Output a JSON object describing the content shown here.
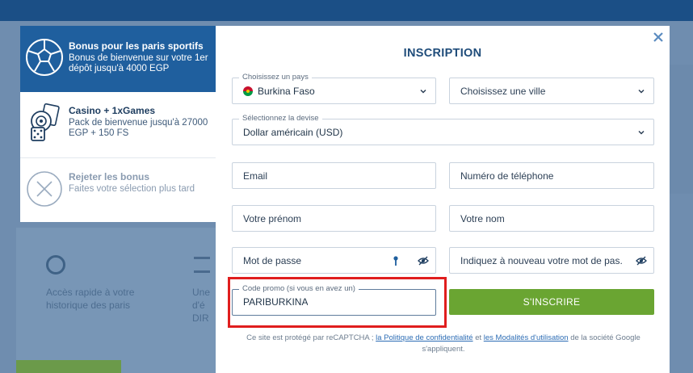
{
  "background": {
    "history_text": "Accès rapide à votre historique des paris",
    "side_text": "Une d'é DIR"
  },
  "bonus_panel": {
    "items": [
      {
        "title": "Bonus pour les paris sportifs",
        "desc": "Bonus de bienvenue sur votre 1er dépôt jusqu'à 4000 EGP",
        "icon": "soccer-ball-icon"
      },
      {
        "title": "Casino + 1xGames",
        "desc": "Pack de bienvenue jusqu'à 27000 EGP + 150 FS",
        "icon": "casino-chip-dice-icon"
      },
      {
        "title": "Rejeter les bonus",
        "desc": "Faites votre sélection plus tard",
        "icon": "close-circle-icon"
      }
    ]
  },
  "modal": {
    "title": "INSCRIPTION",
    "country": {
      "label": "Choisissez un pays",
      "value": "Burkina Faso"
    },
    "city": {
      "placeholder": "Choisissez une ville"
    },
    "currency": {
      "label": "Sélectionnez la devise",
      "value": "Dollar américain (USD)"
    },
    "email": {
      "placeholder": "Email"
    },
    "phone": {
      "placeholder": "Numéro de téléphone"
    },
    "first_name": {
      "placeholder": "Votre prénom"
    },
    "last_name": {
      "placeholder": "Votre nom"
    },
    "password": {
      "placeholder": "Mot de passe"
    },
    "password_confirm": {
      "placeholder": "Indiquez à nouveau votre mot de pas..."
    },
    "promo": {
      "label": "Code promo (si vous en avez un)",
      "value": "PARIBURKINA"
    },
    "submit_label": "S'INSCRIRE",
    "legal": {
      "prefix": "Ce site est protégé par reCAPTCHA ; ",
      "privacy_link": "la Politique de confidentialité",
      "middle": " et ",
      "terms_link": "les Modalités d'utilisation",
      "suffix": " de la société Google s'appliquent."
    }
  },
  "colors": {
    "accent_blue": "#1f5f9e",
    "title_blue": "#1f4c7a",
    "submit_green": "#6aa532",
    "highlight_red": "#e01e1e"
  }
}
